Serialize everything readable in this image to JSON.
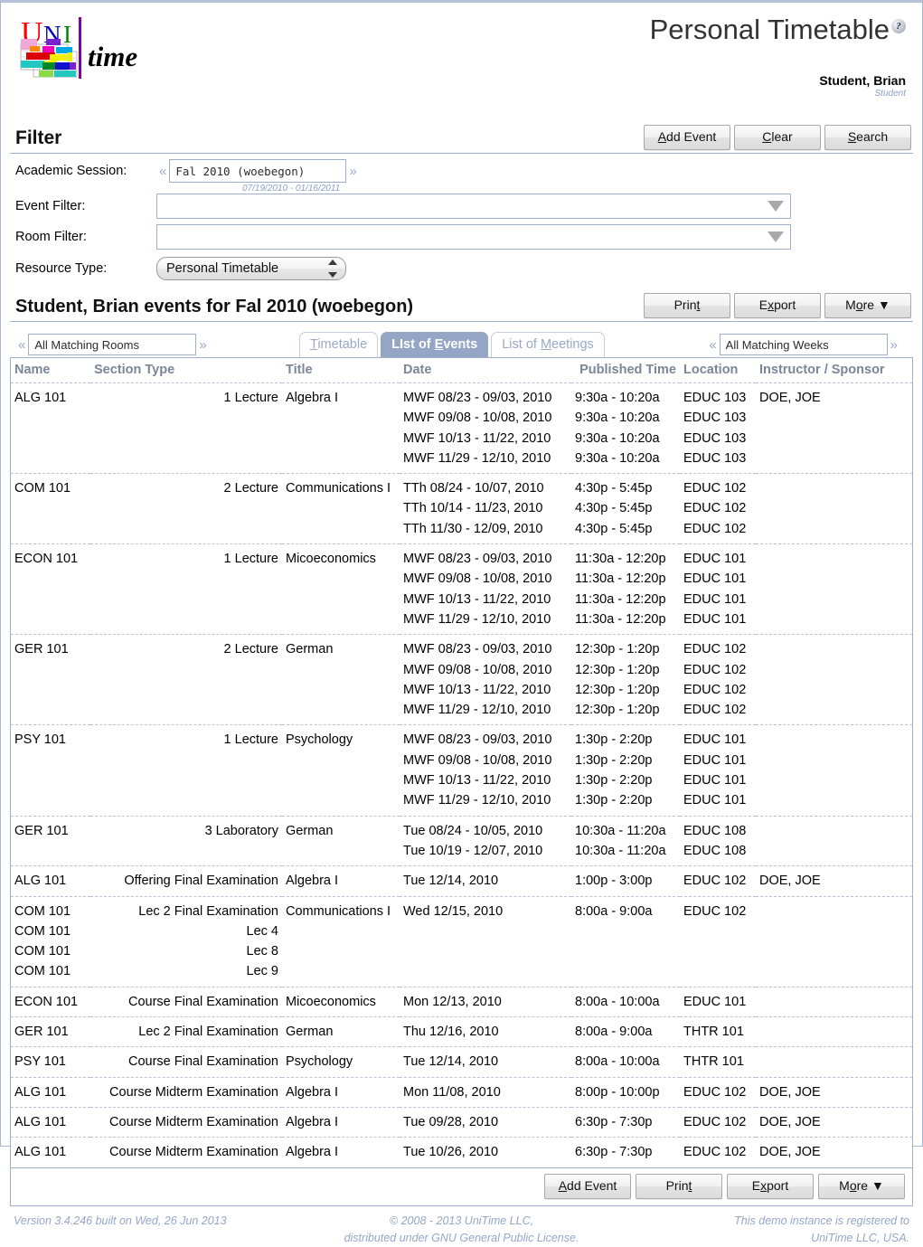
{
  "header": {
    "logo_alt": "UniTime",
    "logo_text_uni": "UNI",
    "logo_text_time": "time",
    "title": "Personal Timetable",
    "help_glyph": "?",
    "user_name": "Student, Brian",
    "user_role": "Student"
  },
  "filter": {
    "heading": "Filter",
    "buttons": {
      "add_event": "Add Event",
      "add_event_key": "A",
      "add_event_rest": "dd Event",
      "clear": "Clear",
      "clear_key": "C",
      "clear_rest": "lear",
      "search": "Search",
      "search_key": "S",
      "search_rest": "earch"
    },
    "academic_session": {
      "label": "Academic Session:",
      "value": "Fal 2010 (woebegon)",
      "dates": "07/19/2010 - 01/16/2011",
      "prev": "«",
      "next": "»"
    },
    "event_filter": {
      "label": "Event Filter:",
      "value": "",
      "placeholder": ""
    },
    "room_filter": {
      "label": "Room Filter:",
      "value": "",
      "placeholder": ""
    },
    "resource_type": {
      "label": "Resource Type:",
      "value": "Personal Timetable",
      "options": [
        "Personal Timetable"
      ]
    }
  },
  "results": {
    "heading": "Student, Brian events for Fal 2010 (woebegon)",
    "buttons": {
      "print": "Print",
      "print_pre": "Prin",
      "print_key": "t",
      "export": "Export",
      "export_pre": "E",
      "export_key": "x",
      "export_rest": "port",
      "more": "More",
      "more_pre": "M",
      "more_key": "o",
      "more_rest": "re",
      "more_caret": "▼"
    },
    "rooms_filter": {
      "value": "All Matching Rooms",
      "prev": "«",
      "next": "»"
    },
    "weeks_filter": {
      "value": "All Matching Weeks",
      "prev": "«",
      "next": "»"
    },
    "tabs": [
      {
        "label": "Timetable",
        "key_pre": "",
        "key": "T",
        "key_rest": "imetable",
        "active": false
      },
      {
        "label": "List of Events",
        "key_pre": "LIst of ",
        "key": "E",
        "key_rest": "vents",
        "active": true
      },
      {
        "label": "List of Meetings",
        "key_pre": "List of ",
        "key": "M",
        "key_rest": "eetings",
        "active": false
      }
    ]
  },
  "table": {
    "columns": [
      "Name",
      "Section Type",
      "Title",
      "Date",
      "Published Time",
      "Location",
      "Instructor / Sponsor"
    ],
    "rows": [
      {
        "name": [
          "ALG 101"
        ],
        "section": [
          "1 Lecture"
        ],
        "title": [
          "Algebra I"
        ],
        "date": [
          "MWF 08/23 - 09/03, 2010",
          "MWF 09/08 - 10/08, 2010",
          "MWF 10/13 - 11/22, 2010",
          "MWF 11/29 - 12/10, 2010"
        ],
        "time": [
          "9:30a - 10:20a",
          "9:30a - 10:20a",
          "9:30a - 10:20a",
          "9:30a - 10:20a"
        ],
        "location": [
          "EDUC 103",
          "EDUC 103",
          "EDUC 103",
          "EDUC 103"
        ],
        "instructor": [
          "DOE, JOE"
        ]
      },
      {
        "name": [
          "COM 101"
        ],
        "section": [
          "2 Lecture"
        ],
        "title": [
          "Communications I"
        ],
        "date": [
          "TTh 08/24 - 10/07, 2010",
          "TTh 10/14 - 11/23, 2010",
          "TTh 11/30 - 12/09, 2010"
        ],
        "time": [
          "4:30p - 5:45p",
          "4:30p - 5:45p",
          "4:30p - 5:45p"
        ],
        "location": [
          "EDUC 102",
          "EDUC 102",
          "EDUC 102"
        ],
        "instructor": []
      },
      {
        "name": [
          "ECON 101"
        ],
        "section": [
          "1 Lecture"
        ],
        "title": [
          "Micoeconomics"
        ],
        "date": [
          "MWF 08/23 - 09/03, 2010",
          "MWF 09/08 - 10/08, 2010",
          "MWF 10/13 - 11/22, 2010",
          "MWF 11/29 - 12/10, 2010"
        ],
        "time": [
          "11:30a - 12:20p",
          "11:30a - 12:20p",
          "11:30a - 12:20p",
          "11:30a - 12:20p"
        ],
        "location": [
          "EDUC 101",
          "EDUC 101",
          "EDUC 101",
          "EDUC 101"
        ],
        "instructor": []
      },
      {
        "name": [
          "GER 101"
        ],
        "section": [
          "2 Lecture"
        ],
        "title": [
          "German"
        ],
        "date": [
          "MWF 08/23 - 09/03, 2010",
          "MWF 09/08 - 10/08, 2010",
          "MWF 10/13 - 11/22, 2010",
          "MWF 11/29 - 12/10, 2010"
        ],
        "time": [
          "12:30p - 1:20p",
          "12:30p - 1:20p",
          "12:30p - 1:20p",
          "12:30p - 1:20p"
        ],
        "location": [
          "EDUC 102",
          "EDUC 102",
          "EDUC 102",
          "EDUC 102"
        ],
        "instructor": []
      },
      {
        "name": [
          "PSY 101"
        ],
        "section": [
          "1 Lecture"
        ],
        "title": [
          "Psychology"
        ],
        "date": [
          "MWF 08/23 - 09/03, 2010",
          "MWF 09/08 - 10/08, 2010",
          "MWF 10/13 - 11/22, 2010",
          "MWF 11/29 - 12/10, 2010"
        ],
        "time": [
          "1:30p - 2:20p",
          "1:30p - 2:20p",
          "1:30p - 2:20p",
          "1:30p - 2:20p"
        ],
        "location": [
          "EDUC 101",
          "EDUC 101",
          "EDUC 101",
          "EDUC 101"
        ],
        "instructor": []
      },
      {
        "name": [
          "GER 101"
        ],
        "section": [
          "3 Laboratory"
        ],
        "title": [
          "German"
        ],
        "date": [
          "Tue 08/24 - 10/05, 2010",
          "Tue 10/19 - 12/07, 2010"
        ],
        "time": [
          "10:30a - 11:20a",
          "10:30a - 11:20a"
        ],
        "location": [
          "EDUC 108",
          "EDUC 108"
        ],
        "instructor": []
      },
      {
        "name": [
          "ALG 101"
        ],
        "section": [
          "Offering Final Examination"
        ],
        "title": [
          "Algebra I"
        ],
        "date": [
          "Tue 12/14, 2010"
        ],
        "time": [
          "1:00p - 3:00p"
        ],
        "location": [
          "EDUC 102"
        ],
        "instructor": [
          "DOE, JOE"
        ]
      },
      {
        "name": [
          "COM 101",
          "COM 101",
          "COM 101",
          "COM 101"
        ],
        "section": [
          "Lec 2 Final Examination",
          "Lec 4",
          "Lec 8",
          "Lec 9"
        ],
        "title": [
          "Communications I"
        ],
        "date": [
          "Wed 12/15, 2010"
        ],
        "time": [
          "8:00a - 9:00a"
        ],
        "location": [
          "EDUC 102"
        ],
        "instructor": []
      },
      {
        "name": [
          "ECON 101"
        ],
        "section": [
          "Course Final Examination"
        ],
        "title": [
          "Micoeconomics"
        ],
        "date": [
          "Mon 12/13, 2010"
        ],
        "time": [
          "8:00a - 10:00a"
        ],
        "location": [
          "EDUC 101"
        ],
        "instructor": []
      },
      {
        "name": [
          "GER 101"
        ],
        "section": [
          "Lec 2 Final Examination"
        ],
        "title": [
          "German"
        ],
        "date": [
          "Thu 12/16, 2010"
        ],
        "time": [
          "8:00a - 9:00a"
        ],
        "location": [
          "THTR 101"
        ],
        "instructor": []
      },
      {
        "name": [
          "PSY 101"
        ],
        "section": [
          "Course Final Examination"
        ],
        "title": [
          "Psychology"
        ],
        "date": [
          "Tue 12/14, 2010"
        ],
        "time": [
          "8:00a - 10:00a"
        ],
        "location": [
          "THTR 101"
        ],
        "instructor": []
      },
      {
        "name": [
          "ALG 101"
        ],
        "section": [
          "Course Midterm Examination"
        ],
        "title": [
          "Algebra I"
        ],
        "date": [
          "Mon 11/08, 2010"
        ],
        "time": [
          "8:00p - 10:00p"
        ],
        "location": [
          "EDUC 102"
        ],
        "instructor": [
          "DOE, JOE"
        ]
      },
      {
        "name": [
          "ALG 101"
        ],
        "section": [
          "Course Midterm Examination"
        ],
        "title": [
          "Algebra I"
        ],
        "date": [
          "Tue 09/28, 2010"
        ],
        "time": [
          "6:30p - 7:30p"
        ],
        "location": [
          "EDUC 102"
        ],
        "instructor": [
          "DOE, JOE"
        ]
      },
      {
        "name": [
          "ALG 101"
        ],
        "section": [
          "Course Midterm Examination"
        ],
        "title": [
          "Algebra I"
        ],
        "date": [
          "Tue 10/26, 2010"
        ],
        "time": [
          "6:30p - 7:30p"
        ],
        "location": [
          "EDUC 102"
        ],
        "instructor": [
          "DOE, JOE"
        ]
      }
    ]
  },
  "bottom_buttons": {
    "add_event_pre": "A",
    "add_event_key": "A",
    "add_event_rest": "dd Event",
    "print_pre": "Prin",
    "print_key": "t",
    "export_pre": "E",
    "export_key": "x",
    "export_rest": "port",
    "more_pre": "M",
    "more_key": "o",
    "more_rest": "re",
    "more_caret": "▼"
  },
  "footer": {
    "version": "Version 3.4.246 built on Wed, 26 Jun 2013",
    "copyright_line1": "© 2008 - 2013 UniTime LLC,",
    "copyright_line2": "distributed under GNU General Public License.",
    "registered_line1": "This demo instance is registered to",
    "registered_line2": "UniTime LLC, USA."
  },
  "colors": {
    "accent": "#95a5c6",
    "border": "#9eb0ce",
    "muted_text": "#94a6c9",
    "header_text": "#7b8699"
  }
}
